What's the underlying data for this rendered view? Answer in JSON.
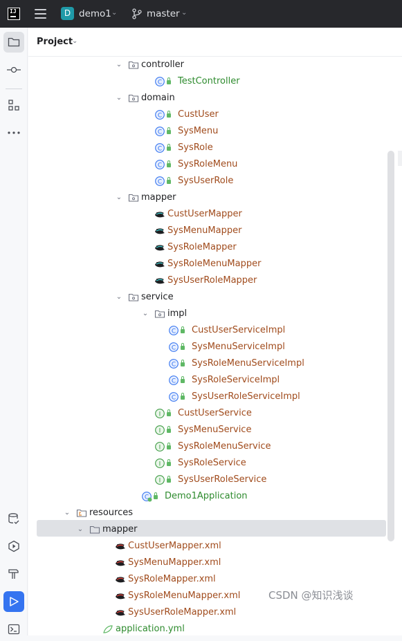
{
  "topbar": {
    "logo_text": "IJ",
    "project_badge": "D",
    "project_name": "demo1",
    "branch_name": "master"
  },
  "panel": {
    "title": "Project"
  },
  "tree": [
    {
      "label": "controller",
      "kind": "folder",
      "color": "dark"
    },
    {
      "label": "TestController",
      "kind": "class",
      "color": "green"
    },
    {
      "label": "domain",
      "kind": "folder",
      "color": "dark"
    },
    {
      "label": "CustUser",
      "kind": "class",
      "color": "red"
    },
    {
      "label": "SysMenu",
      "kind": "class",
      "color": "red"
    },
    {
      "label": "SysRole",
      "kind": "class",
      "color": "red"
    },
    {
      "label": "SysRoleMenu",
      "kind": "class",
      "color": "red"
    },
    {
      "label": "SysUserRole",
      "kind": "class",
      "color": "red"
    },
    {
      "label": "mapper",
      "kind": "folder",
      "color": "dark"
    },
    {
      "label": "CustUserMapper",
      "kind": "mybatis",
      "color": "red"
    },
    {
      "label": "SysMenuMapper",
      "kind": "mybatis",
      "color": "red"
    },
    {
      "label": "SysRoleMapper",
      "kind": "mybatis",
      "color": "red"
    },
    {
      "label": "SysRoleMenuMapper",
      "kind": "mybatis",
      "color": "red"
    },
    {
      "label": "SysUserRoleMapper",
      "kind": "mybatis",
      "color": "red"
    },
    {
      "label": "service",
      "kind": "folder",
      "color": "dark"
    },
    {
      "label": "impl",
      "kind": "folder",
      "color": "dark"
    },
    {
      "label": "CustUserServiceImpl",
      "kind": "class",
      "color": "red"
    },
    {
      "label": "SysMenuServiceImpl",
      "kind": "class",
      "color": "red"
    },
    {
      "label": "SysRoleMenuServiceImpl",
      "kind": "class",
      "color": "red"
    },
    {
      "label": "SysRoleServiceImpl",
      "kind": "class",
      "color": "red"
    },
    {
      "label": "SysUserRoleServiceImpl",
      "kind": "class",
      "color": "red"
    },
    {
      "label": "CustUserService",
      "kind": "interface",
      "color": "red"
    },
    {
      "label": "SysMenuService",
      "kind": "interface",
      "color": "red"
    },
    {
      "label": "SysRoleMenuService",
      "kind": "interface",
      "color": "red"
    },
    {
      "label": "SysRoleService",
      "kind": "interface",
      "color": "red"
    },
    {
      "label": "SysUserRoleService",
      "kind": "interface",
      "color": "red"
    },
    {
      "label": "Demo1Application",
      "kind": "app",
      "color": "green"
    },
    {
      "label": "resources",
      "kind": "resfolder",
      "color": "dark"
    },
    {
      "label": "mapper",
      "kind": "plainfolder",
      "color": "dark"
    },
    {
      "label": "CustUserMapper.xml",
      "kind": "mybatis-xml",
      "color": "red"
    },
    {
      "label": "SysMenuMapper.xml",
      "kind": "mybatis-xml",
      "color": "red"
    },
    {
      "label": "SysRoleMapper.xml",
      "kind": "mybatis-xml",
      "color": "red"
    },
    {
      "label": "SysRoleMenuMapper.xml",
      "kind": "mybatis-xml",
      "color": "red"
    },
    {
      "label": "SysUserRoleMapper.xml",
      "kind": "mybatis-xml",
      "color": "red"
    },
    {
      "label": "application.yml",
      "kind": "yml",
      "color": "green"
    }
  ],
  "watermark": "CSDN @知识浅谈",
  "colors": {
    "accent": "#3574f0",
    "selection": "#dfe1e5",
    "modified_red": "#a04b1c",
    "added_green": "#2e8b2e"
  }
}
